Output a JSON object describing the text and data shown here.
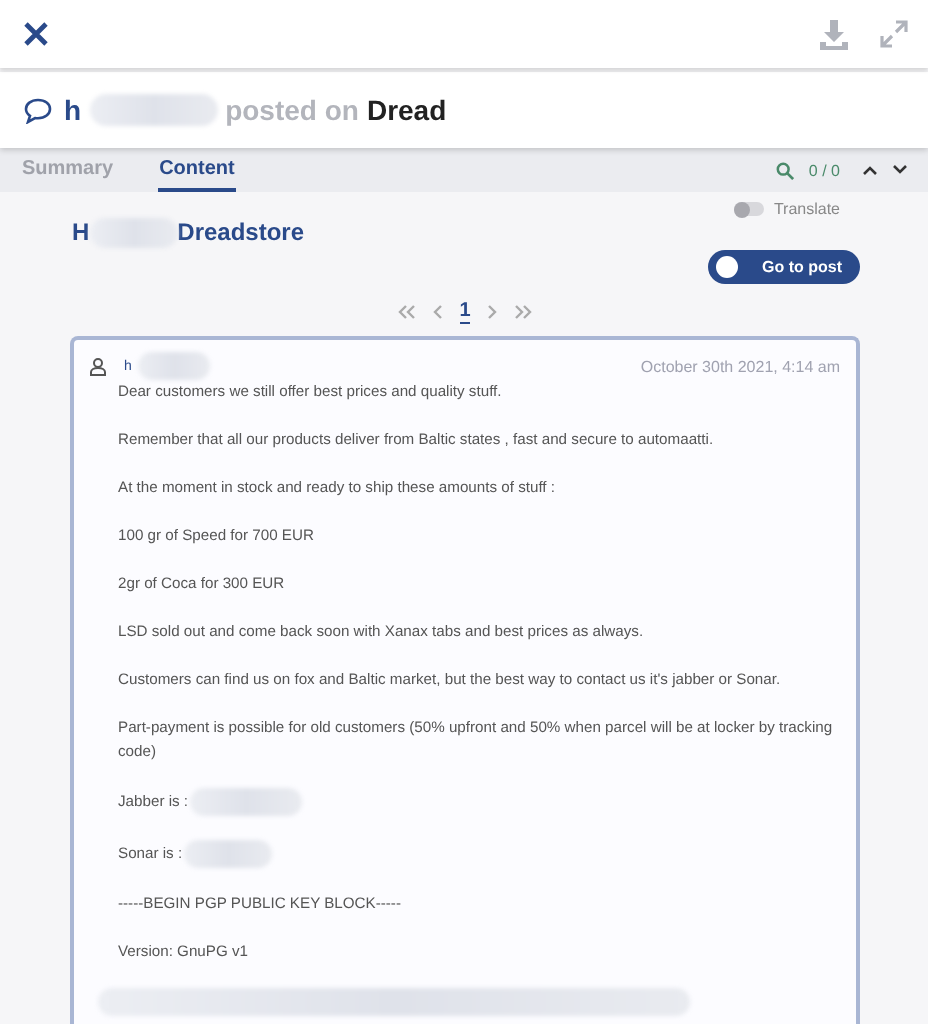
{
  "header": {
    "author": "h",
    "posted_on": "posted on",
    "site": "Dread"
  },
  "tabs": [
    {
      "label": "Summary",
      "selected": false
    },
    {
      "label": "Content",
      "selected": true
    }
  ],
  "search": {
    "count": "0 / 0"
  },
  "translate": {
    "label": "Translate",
    "on": false
  },
  "store": {
    "name_start": "H",
    "name_end": "Dreadstore"
  },
  "go_to_post": "Go to post",
  "pagination": {
    "current": "1"
  },
  "post": {
    "author": "h",
    "date": "October 30th 2021, 4:14 am",
    "paragraphs": [
      {
        "kind": "text",
        "text": "Dear customers we still offer best prices and quality stuff."
      },
      {
        "kind": "text",
        "text": "Remember that all our products deliver from Baltic states , fast and secure to automaatti."
      },
      {
        "kind": "text",
        "text": "At the moment in stock and ready to ship these amounts of stuff :"
      },
      {
        "kind": "text",
        "text": "100 gr of Speed for 700 EUR"
      },
      {
        "kind": "text",
        "text": "2gr of Coca for 300 EUR"
      },
      {
        "kind": "text",
        "text": "LSD sold out and come back soon with Xanax tabs and best prices as always."
      },
      {
        "kind": "text",
        "text": "Customers can find us on fox and Baltic market, but the best way to contact us it's jabber or Sonar."
      },
      {
        "kind": "text",
        "text": "Part-payment is possible for old customers (50% upfront and 50% when parcel will be at locker by tracking code)"
      },
      {
        "kind": "redacted_after",
        "text": "Jabber is :"
      },
      {
        "kind": "redacted_after",
        "text": "Sonar is :"
      },
      {
        "kind": "text",
        "text": "-----BEGIN PGP PUBLIC KEY BLOCK-----"
      },
      {
        "kind": "text",
        "text": "Version: GnuPG v1"
      },
      {
        "kind": "redacted"
      }
    ]
  }
}
